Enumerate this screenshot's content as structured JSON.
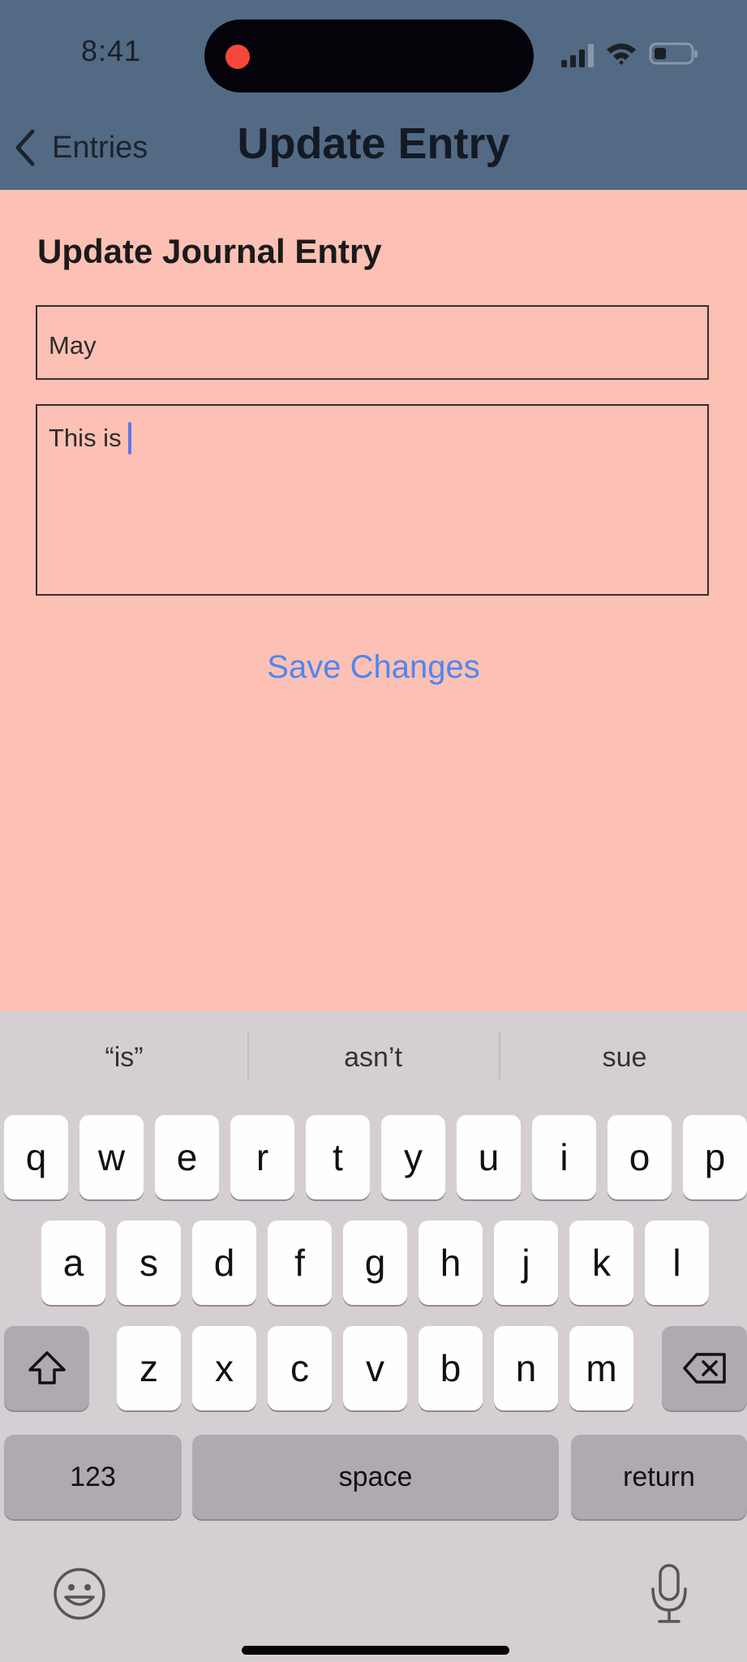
{
  "status_bar": {
    "time": "8:41",
    "icons": [
      "recording-dot-icon",
      "cellular-signal-icon",
      "wifi-icon",
      "battery-icon"
    ]
  },
  "nav": {
    "back_label": "Entries",
    "back_icon": "chevron-left-icon",
    "title": "Update Entry"
  },
  "form": {
    "heading": "Update Journal Entry",
    "title_value": "May",
    "body_value": "This is",
    "save_label": "Save Changes"
  },
  "keyboard": {
    "suggestions": [
      "“is”",
      "asn’t",
      "sue"
    ],
    "rows": [
      [
        "q",
        "w",
        "e",
        "r",
        "t",
        "y",
        "u",
        "i",
        "o",
        "p"
      ],
      [
        "a",
        "s",
        "d",
        "f",
        "g",
        "h",
        "j",
        "k",
        "l"
      ],
      [
        "z",
        "x",
        "c",
        "v",
        "b",
        "n",
        "m"
      ]
    ],
    "numbers_label": "123",
    "space_label": "space",
    "return_label": "return",
    "shift_icon": "shift-icon",
    "delete_icon": "backspace-icon",
    "emoji_icon": "emoji-icon",
    "mic_icon": "microphone-icon"
  },
  "colors": {
    "nav_bg": "#536a85",
    "content_bg": "#fdc0b4",
    "accent": "#4f86f0",
    "keyboard_bg": "#d5cfd4"
  }
}
